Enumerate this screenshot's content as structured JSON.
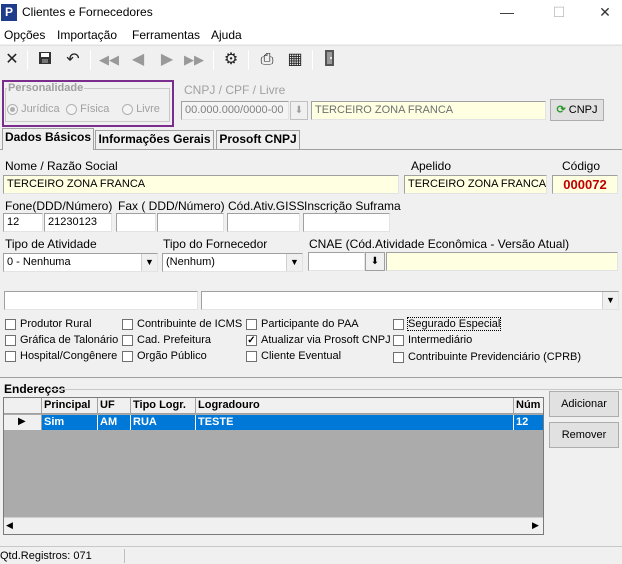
{
  "window": {
    "title": "Clientes e Fornecedores",
    "app_icon_letter": "P",
    "controls": {
      "minimize": "—",
      "maximize": "☐",
      "close": "✕"
    }
  },
  "menu": [
    "Opções",
    "Importação",
    "Ferramentas",
    "Ajuda"
  ],
  "toolbar": {
    "icons": [
      "close-icon",
      "save-icon",
      "undo-icon",
      "first-record-icon",
      "previous-record-icon",
      "next-record-icon",
      "last-record-icon",
      "tools-icon",
      "print-icon",
      "report-icon",
      "exit-door-icon"
    ]
  },
  "personalidade": {
    "legend": "Personalidade",
    "options": [
      "Jurídica",
      "Física",
      "Livre"
    ],
    "selected": "Jurídica",
    "highlight_color": "#7b2d8e"
  },
  "cnpj": {
    "label": "CNPJ / CPF / Livre",
    "value": "00.000.000/0000-00",
    "name_value": "TERCEIRO ZONA FRANCA",
    "button_label": "CNPJ"
  },
  "tabs": [
    "Dados Básicos",
    "Informações Gerais",
    "Prosoft CNPJ"
  ],
  "dados": {
    "nome_label": "Nome / Razão Social",
    "nome_value": "TERCEIRO ZONA FRANCA",
    "apelido_label": "Apelido",
    "apelido_value": "TERCEIRO ZONA FRANCA",
    "codigo_label": "Código",
    "codigo_value": "000072",
    "codigo_color": "#c00000",
    "fone_label": "Fone(DDD/Número)",
    "fone_ddd": "12",
    "fone_numero": "21230123",
    "fax_label": "Fax ( DDD/Número)",
    "fax_ddd": "",
    "fax_numero": "",
    "giss_label": "Cód.Ativ.GISS",
    "giss_value": "",
    "suframa_label": "Inscrição Suframa",
    "suframa_value": "",
    "tipo_atividade_label": "Tipo de Atividade",
    "tipo_atividade_value": "0 - Nenhuma",
    "tipo_fornecedor_label": "Tipo do Fornecedor",
    "tipo_fornecedor_value": "(Nenhum)",
    "cnae_label": "CNAE (Cód.Atividade Econômica - Versão Atual)",
    "cnae_code": "",
    "cnae_desc": ""
  },
  "checkboxes": [
    {
      "label": "Produtor Rural",
      "checked": false
    },
    {
      "label": "Gráfica de Talonário",
      "checked": false
    },
    {
      "label": "Hospital/Congênere",
      "checked": false
    },
    {
      "label": "Contribuinte de ICMS",
      "checked": false
    },
    {
      "label": "Cad. Prefeitura",
      "checked": false
    },
    {
      "label": "Orgão Público",
      "checked": false
    },
    {
      "label": "Participante do PAA",
      "checked": false
    },
    {
      "label": "Atualizar via Prosoft CNPJ",
      "checked": true
    },
    {
      "label": "Cliente Eventual",
      "checked": false
    },
    {
      "label": "Segurado Especial",
      "checked": false
    },
    {
      "label": "Intermediário",
      "checked": false
    },
    {
      "label": "Contribuinte Previdenciário (CPRB)",
      "checked": false
    }
  ],
  "enderecos": {
    "title": "Endereços",
    "columns": [
      "Principal",
      "UF",
      "Tipo Logr.",
      "Logradouro",
      "Núm"
    ],
    "rows": [
      {
        "principal": "Sim",
        "uf": "AM",
        "tipo": "RUA",
        "logradouro": "TESTE",
        "numero": "12"
      }
    ],
    "add_button": "Adicionar",
    "remove_button": "Remover"
  },
  "status": {
    "registros": "Qtd.Registros: 071"
  }
}
